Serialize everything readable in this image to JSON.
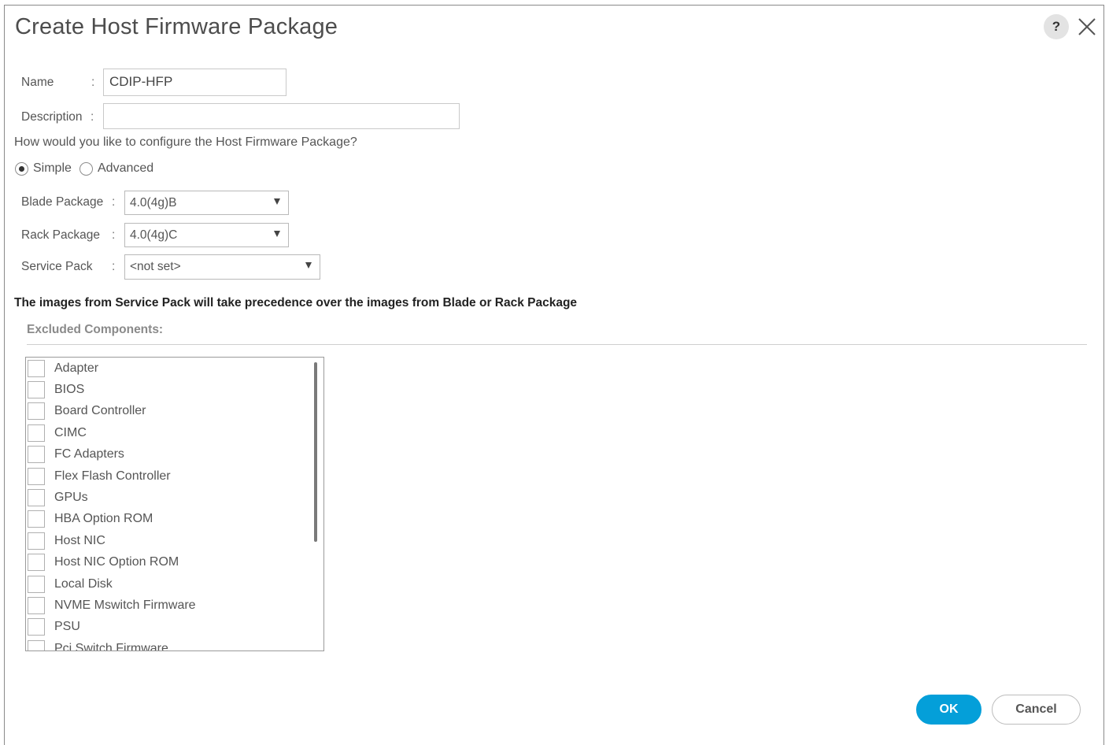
{
  "dialog": {
    "title": "Create Host Firmware Package",
    "help_label": "?"
  },
  "form": {
    "name_label": "Name",
    "name_colon": ":",
    "name_value": "CDIP-HFP",
    "description_label": "Description",
    "description_colon": ":",
    "description_value": "",
    "config_question": "How would you like to configure the Host Firmware Package?",
    "mode_options": [
      {
        "label": "Simple",
        "selected": true
      },
      {
        "label": "Advanced",
        "selected": false
      }
    ],
    "blade_package_label": "Blade Package",
    "blade_package_value": "4.0(4g)B",
    "rack_package_label": "Rack Package",
    "rack_package_value": "4.0(4g)C",
    "service_pack_label": "Service Pack",
    "service_pack_value": "<not set>",
    "colon": ":"
  },
  "notice": "The images from Service Pack will take precedence over the images from Blade or Rack Package",
  "excluded": {
    "heading": "Excluded Components:",
    "items": [
      {
        "label": "Adapter",
        "checked": false
      },
      {
        "label": "BIOS",
        "checked": false
      },
      {
        "label": "Board Controller",
        "checked": false
      },
      {
        "label": "CIMC",
        "checked": false
      },
      {
        "label": "FC Adapters",
        "checked": false
      },
      {
        "label": "Flex Flash Controller",
        "checked": false
      },
      {
        "label": "GPUs",
        "checked": false
      },
      {
        "label": "HBA Option ROM",
        "checked": false
      },
      {
        "label": "Host NIC",
        "checked": false
      },
      {
        "label": "Host NIC Option ROM",
        "checked": false
      },
      {
        "label": "Local Disk",
        "checked": false
      },
      {
        "label": "NVME Mswitch Firmware",
        "checked": false
      },
      {
        "label": "PSU",
        "checked": false
      },
      {
        "label": "Pci Switch Firmware",
        "checked": false
      }
    ]
  },
  "buttons": {
    "ok": "OK",
    "cancel": "Cancel"
  },
  "colors": {
    "primary": "#049fd9",
    "border": "#8a8a8a"
  }
}
